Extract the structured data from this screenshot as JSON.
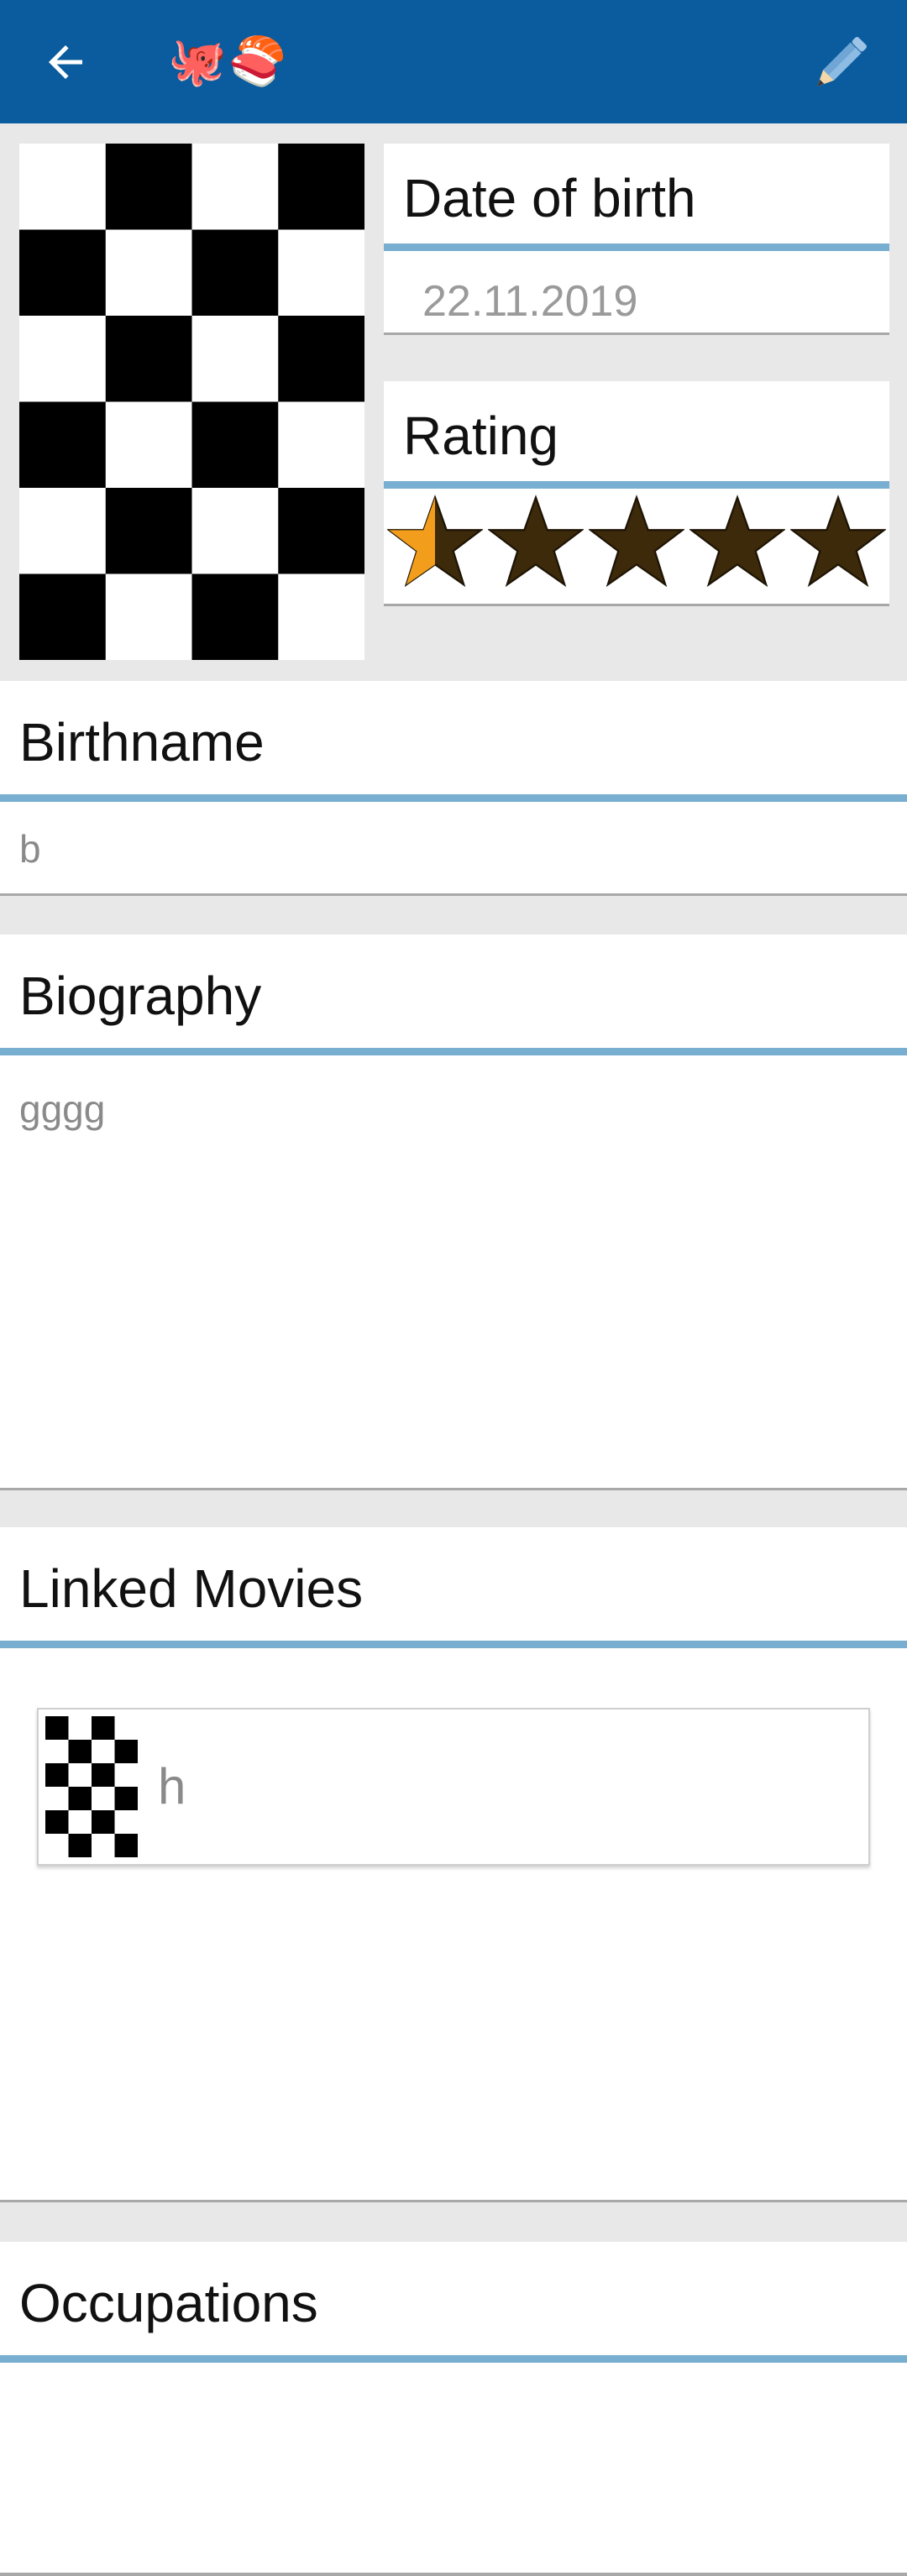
{
  "app_bar": {
    "back_icon": "arrow-back-icon",
    "title_emoji": "🐙🍣",
    "edit_icon": "pencil-icon",
    "background_color": "#0b5c9e"
  },
  "portrait": {
    "image": "checkerboard-placeholder-image"
  },
  "date_of_birth": {
    "label": "Date of birth",
    "value": "22.11.2019"
  },
  "rating": {
    "label": "Rating",
    "value": 0.5,
    "max": 5,
    "filled_color": "#f29d1b",
    "empty_color": "#3d2a0b"
  },
  "birthname": {
    "label": "Birthname",
    "value": "b"
  },
  "biography": {
    "label": "Biography",
    "value": "gggg"
  },
  "linked_movies": {
    "label": "Linked Movies",
    "items": [
      {
        "title": "h",
        "thumbnail": "checkerboard-thumbnail"
      }
    ]
  },
  "occupations": {
    "label": "Occupations",
    "items": []
  },
  "accent_color": "#78aed0"
}
